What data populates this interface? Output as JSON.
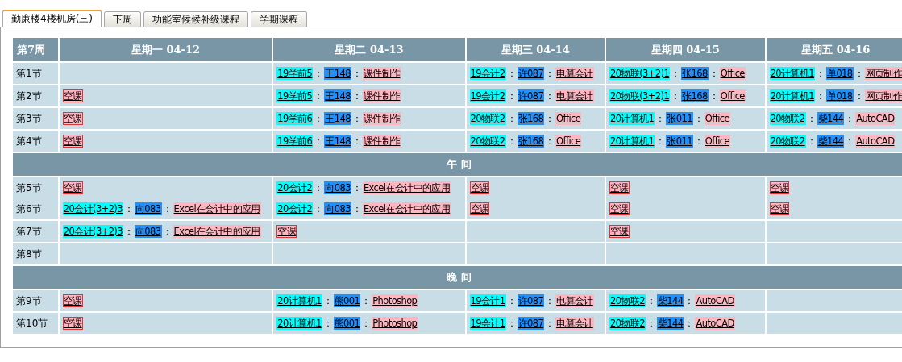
{
  "tabs": [
    {
      "label": "勤廉楼4楼机房(三)",
      "selected": true
    },
    {
      "label": "下周",
      "selected": false
    },
    {
      "label": "功能室候候补级课程",
      "selected": false
    },
    {
      "label": "学期课程",
      "selected": false
    }
  ],
  "timetable": {
    "separator": "：",
    "week": "第7周",
    "days": [
      "星期一 04-12",
      "星期二 04-13",
      "星期三 04-14",
      "星期四 04-15",
      "星期五 04-16"
    ],
    "rows": [
      {
        "kind": "periods",
        "labels": [
          "第1节"
        ],
        "cells": [
          [],
          [
            {
              "kind": "lesson",
              "parts": [
                "19学前5",
                "王148",
                "课件制作"
              ]
            }
          ],
          [
            {
              "kind": "lesson",
              "parts": [
                "19会计2",
                "许087",
                "电算会计"
              ]
            }
          ],
          [
            {
              "kind": "lesson",
              "parts": [
                "20物联(3+2)1",
                "张168",
                "Office"
              ]
            }
          ],
          [
            {
              "kind": "lesson",
              "parts": [
                "20计算机1",
                "单018",
                "网页制作"
              ]
            }
          ]
        ]
      },
      {
        "kind": "periods",
        "labels": [
          "第2节"
        ],
        "cells": [
          [
            {
              "kind": "empty",
              "text": "空课",
              "outlined": true
            }
          ],
          [
            {
              "kind": "lesson",
              "parts": [
                "19学前5",
                "王148",
                "课件制作"
              ]
            }
          ],
          [
            {
              "kind": "lesson",
              "parts": [
                "19会计2",
                "许087",
                "电算会计"
              ]
            }
          ],
          [
            {
              "kind": "lesson",
              "parts": [
                "20物联(3+2)1",
                "张168",
                "Office"
              ]
            }
          ],
          [
            {
              "kind": "lesson",
              "parts": [
                "20计算机1",
                "单018",
                "网页制作"
              ]
            }
          ]
        ]
      },
      {
        "kind": "periods",
        "labels": [
          "第3节"
        ],
        "cells": [
          [
            {
              "kind": "empty",
              "text": "空课",
              "outlined": true
            }
          ],
          [
            {
              "kind": "lesson",
              "parts": [
                "19学前6",
                "王148",
                "课件制作"
              ]
            }
          ],
          [
            {
              "kind": "lesson",
              "parts": [
                "20物联2",
                "张168",
                "Office"
              ]
            }
          ],
          [
            {
              "kind": "lesson",
              "parts": [
                "20计算机1",
                "张011",
                "Office"
              ]
            }
          ],
          [
            {
              "kind": "lesson",
              "parts": [
                "20物联2",
                "柴144",
                "AutoCAD"
              ]
            }
          ]
        ]
      },
      {
        "kind": "periods",
        "labels": [
          "第4节"
        ],
        "cells": [
          [
            {
              "kind": "empty",
              "text": "空课",
              "outlined": true
            }
          ],
          [
            {
              "kind": "lesson",
              "parts": [
                "19学前6",
                "王148",
                "课件制作"
              ]
            }
          ],
          [
            {
              "kind": "lesson",
              "parts": [
                "20物联2",
                "张168",
                "Office"
              ]
            }
          ],
          [
            {
              "kind": "lesson",
              "parts": [
                "20计算机1",
                "张011",
                "Office"
              ]
            }
          ],
          [
            {
              "kind": "lesson",
              "parts": [
                "20物联2",
                "柴144",
                "AutoCAD"
              ]
            }
          ]
        ]
      },
      {
        "kind": "break",
        "label": "午 间"
      },
      {
        "kind": "periods",
        "labels": [
          "第5节",
          "第6节"
        ],
        "cells": [
          [
            {
              "kind": "empty",
              "text": "空课",
              "outlined": true
            },
            {
              "kind": "lesson",
              "parts": [
                "20会计(3+2)3",
                "向083",
                "Excel在会计中的应用"
              ]
            }
          ],
          [
            {
              "kind": "lesson",
              "parts": [
                "20会计2",
                "向083",
                "Excel在会计中的应用"
              ]
            },
            {
              "kind": "lesson",
              "parts": [
                "20会计2",
                "向083",
                "Excel在会计中的应用"
              ]
            }
          ],
          [
            {
              "kind": "empty",
              "text": "空课",
              "outlined": true
            },
            {
              "kind": "empty",
              "text": "空课",
              "outlined": true
            }
          ],
          [
            {
              "kind": "empty",
              "text": "空课",
              "outlined": true
            },
            {
              "kind": "empty",
              "text": "空课",
              "outlined": true
            }
          ],
          [
            {
              "kind": "empty",
              "text": "空课",
              "outlined": true
            },
            {
              "kind": "empty",
              "text": "空课",
              "outlined": true
            }
          ]
        ]
      },
      {
        "kind": "periods",
        "labels": [
          "第7节"
        ],
        "cells": [
          [
            {
              "kind": "lesson",
              "parts": [
                "20会计(3+2)3",
                "向083",
                "Excel在会计中的应用"
              ]
            }
          ],
          [
            {
              "kind": "empty",
              "text": "空课",
              "outlined": true
            }
          ],
          [],
          [
            {
              "kind": "empty",
              "text": "空课",
              "outlined": true
            }
          ],
          []
        ]
      },
      {
        "kind": "periods",
        "labels": [
          "第8节"
        ],
        "cells": [
          [],
          [],
          [],
          [],
          []
        ]
      },
      {
        "kind": "break",
        "label": "晚 间"
      },
      {
        "kind": "periods",
        "labels": [
          "第9节"
        ],
        "cells": [
          [
            {
              "kind": "empty",
              "text": "空课",
              "outlined": true
            }
          ],
          [
            {
              "kind": "lesson",
              "parts": [
                "20计算机1",
                "熊001",
                "Photoshop"
              ]
            }
          ],
          [
            {
              "kind": "lesson",
              "parts": [
                "19会计1",
                "许087",
                "电算会计"
              ]
            }
          ],
          [
            {
              "kind": "lesson",
              "parts": [
                "20物联2",
                "柴144",
                "AutoCAD"
              ]
            }
          ],
          []
        ]
      },
      {
        "kind": "periods",
        "labels": [
          "第10节"
        ],
        "cells": [
          [
            {
              "kind": "empty",
              "text": "空课",
              "outlined": true
            }
          ],
          [
            {
              "kind": "lesson",
              "parts": [
                "20计算机1",
                "熊001",
                "Photoshop"
              ]
            }
          ],
          [
            {
              "kind": "lesson",
              "parts": [
                "19会计1",
                "许087",
                "电算会计"
              ]
            }
          ],
          [
            {
              "kind": "lesson",
              "parts": [
                "20物联2",
                "柴144",
                "AutoCAD"
              ]
            }
          ],
          []
        ]
      }
    ]
  }
}
